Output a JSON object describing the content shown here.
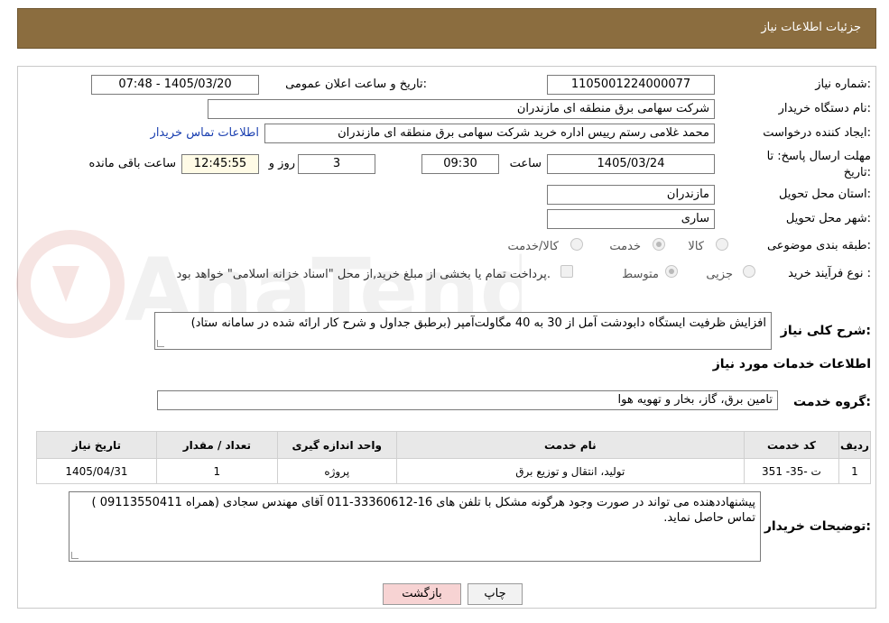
{
  "header": {
    "title": "جزئیات اطلاعات نیاز"
  },
  "form": {
    "need_number_label": "شماره نیاز:",
    "need_number": "1105001224000077",
    "announce_label": "تاریخ و ساعت اعلان عمومی:",
    "announce_value": "1405/03/20 - 07:48",
    "buyer_org_label": "نام دستگاه خریدار:",
    "buyer_org": "شرکت سهامی برق منطقه ای مازندران",
    "requester_label": "ایجاد کننده درخواست:",
    "requester": "محمد غلامی رستم رییس اداره خرید شرکت سهامی برق منطقه ای مازندران",
    "contact_link": "اطلاعات تماس خریدار",
    "deadline_label_1": "مهلت ارسال پاسخ: تا",
    "deadline_label_2": "تاریخ:",
    "deadline_date": "1405/03/24",
    "time_label": "ساعت",
    "deadline_time": "09:30",
    "days_value": "3",
    "days_label": "روز و",
    "remaining_value": "12:45:55",
    "remaining_label": "ساعت باقی مانده",
    "province_label": "استان محل تحویل:",
    "province": "مازندران",
    "city_label": "شهر محل تحویل:",
    "city": "ساری",
    "category_label": "طبقه بندی موضوعی:",
    "category_options": [
      "کالا",
      "خدمت",
      "کالا/خدمت"
    ],
    "process_label": "نوع فرآیند خرید :",
    "process_options": [
      "جزیی",
      "متوسط"
    ],
    "payment_note": "پرداخت تمام یا بخشی از مبلغ خرید,از محل \"اسناد خزانه اسلامی\" خواهد بود.",
    "summary_label": "شرح کلی نیاز:",
    "summary": "افزایش ظرفیت ایستگاه دابودشت آمل از 30 به 40 مگاولت‌آمپر (برطبق جداول و شرح کار ارائه شده در سامانه ستاد)",
    "services_heading": "اطلاعات خدمات مورد نیاز",
    "service_group_label": "گروه خدمت:",
    "service_group": "تامین برق، گاز، بخار و تهویه هوا",
    "buyer_notes_label": "توضیحات خریدار:",
    "buyer_notes": "پیشنهاددهنده می تواند در صورت وجود هرگونه مشکل با تلفن های 16-33360612-011 آقای مهندس سجادی (همراه  09113550411 ) تماس حاصل نماید."
  },
  "table": {
    "headers": [
      "ردیف",
      "کد خدمت",
      "نام خدمت",
      "واحد اندازه گیری",
      "تعداد / مقدار",
      "تاریخ نیاز"
    ],
    "rows": [
      [
        "1",
        "ت -35- 351",
        "تولید، انتقال و توزیع برق",
        "پروژه",
        "1",
        "1405/04/31"
      ]
    ]
  },
  "buttons": {
    "print": "چاپ",
    "back": "بازگشت"
  },
  "colors": {
    "header_bg": "#8b6d3f",
    "back_button_bg": "#f7d3d3",
    "link": "#1a3fb0"
  }
}
